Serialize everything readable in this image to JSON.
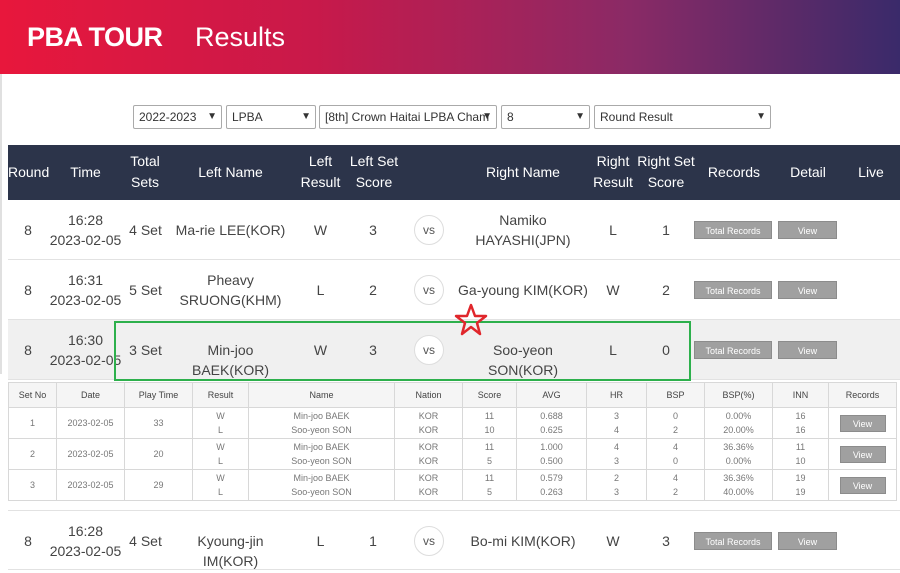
{
  "header": {
    "logo": "PBA TOUR",
    "title": "Results"
  },
  "filters": {
    "season": "2022-2023",
    "league": "LPBA",
    "tournament": "[8th] Crown Haitai LPBA Cham",
    "round": "8",
    "view": "Round Result"
  },
  "columns": {
    "round": "Round",
    "time": "Time",
    "total_sets_1": "Total",
    "total_sets_2": "Sets",
    "left_name": "Left Name",
    "left_result_1": "Left",
    "left_result_2": "Result",
    "left_score_1": "Left Set",
    "left_score_2": "Score",
    "right_name": "Right Name",
    "right_result_1": "Right",
    "right_result_2": "Result",
    "right_score_1": "Right Set",
    "right_score_2": "Score",
    "records": "Records",
    "detail": "Detail",
    "live": "Live"
  },
  "vs_label": "vs",
  "total_records_label": "Total Records",
  "view_label": "View",
  "matches": [
    {
      "round": "8",
      "time": "16:28",
      "date": "2023-02-05",
      "sets": "4 Set",
      "left_name": "Ma-rie LEE(KOR)",
      "left_result": "W",
      "left_score": "3",
      "right_name_1": "Namiko",
      "right_name_2": "HAYASHI(JPN)",
      "right_result": "L",
      "right_score": "1"
    },
    {
      "round": "8",
      "time": "16:31",
      "date": "2023-02-05",
      "sets": "5 Set",
      "left_name_1": "Pheavy",
      "left_name_2": "SRUONG(KHM)",
      "left_result": "L",
      "left_score": "2",
      "right_name": "Ga-young KIM(KOR)",
      "right_result": "W",
      "right_score": "2"
    },
    {
      "round": "8",
      "time": "16:30",
      "date": "2023-02-05",
      "sets": "3 Set",
      "left_name": "Min-joo BAEK(KOR)",
      "left_result": "W",
      "left_score": "3",
      "right_name": "Soo-yeon SON(KOR)",
      "right_result": "L",
      "right_score": "0"
    },
    {
      "round": "8",
      "time": "16:28",
      "date": "2023-02-05",
      "sets": "4 Set",
      "left_name": "Kyoung-jin IM(KOR)",
      "left_result": "L",
      "left_score": "1",
      "right_name": "Bo-mi KIM(KOR)",
      "right_result": "W",
      "right_score": "3"
    }
  ],
  "set_detail": {
    "columns": [
      "Set No",
      "Date",
      "Play Time",
      "Result",
      "Name",
      "Nation",
      "Score",
      "AVG",
      "HR",
      "BSP",
      "BSP(%)",
      "INN",
      "Records"
    ],
    "rows": [
      {
        "set": "1",
        "date": "2023-02-05",
        "play_time": "33",
        "p1": {
          "result": "W",
          "name": "Min-joo BAEK",
          "nation": "KOR",
          "score": "11",
          "avg": "0.688",
          "hr": "3",
          "bsp": "0",
          "bsp_pct": "0.00%",
          "inn": "16"
        },
        "p2": {
          "result": "L",
          "name": "Soo-yeon SON",
          "nation": "KOR",
          "score": "10",
          "avg": "0.625",
          "hr": "4",
          "bsp": "2",
          "bsp_pct": "20.00%",
          "inn": "16"
        }
      },
      {
        "set": "2",
        "date": "2023-02-05",
        "play_time": "20",
        "p1": {
          "result": "W",
          "name": "Min-joo BAEK",
          "nation": "KOR",
          "score": "11",
          "avg": "1.000",
          "hr": "4",
          "bsp": "4",
          "bsp_pct": "36.36%",
          "inn": "11"
        },
        "p2": {
          "result": "L",
          "name": "Soo-yeon SON",
          "nation": "KOR",
          "score": "5",
          "avg": "0.500",
          "hr": "3",
          "bsp": "0",
          "bsp_pct": "0.00%",
          "inn": "10"
        }
      },
      {
        "set": "3",
        "date": "2023-02-05",
        "play_time": "29",
        "p1": {
          "result": "W",
          "name": "Min-joo BAEK",
          "nation": "KOR",
          "score": "11",
          "avg": "0.579",
          "hr": "2",
          "bsp": "4",
          "bsp_pct": "36.36%",
          "inn": "19"
        },
        "p2": {
          "result": "L",
          "name": "Soo-yeon SON",
          "nation": "KOR",
          "score": "5",
          "avg": "0.263",
          "hr": "3",
          "bsp": "2",
          "bsp_pct": "40.00%",
          "inn": "19"
        }
      }
    ]
  },
  "colors": {
    "banner_start": "#e8173c",
    "banner_end": "#3a2a6a",
    "header_bg": "#2c344a",
    "highlight_box": "#2db04c",
    "annotation_star": "#e0262b"
  }
}
